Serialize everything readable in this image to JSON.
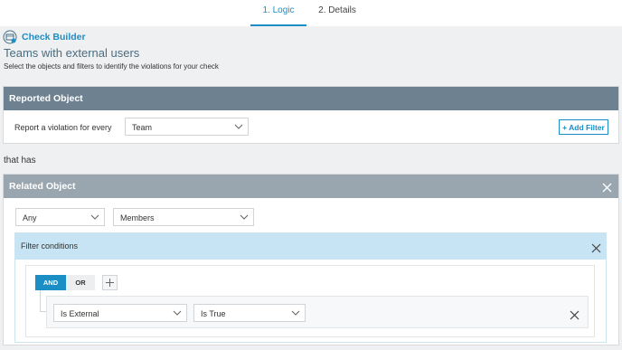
{
  "tabs": [
    {
      "label": "1. Logic",
      "active": true
    },
    {
      "label": "2. Details",
      "active": false
    }
  ],
  "header": {
    "app_title": "Check Builder",
    "page_title": "Teams with external users",
    "description": "Select the objects and filters to identify the violations for your check"
  },
  "reported_object": {
    "title": "Reported Object",
    "label": "Report a violation for every",
    "selected": "Team",
    "add_filter": "+ Add Filter"
  },
  "connector_text": "that has",
  "related_object": {
    "title": "Related Object",
    "quantifier": "Any",
    "relation": "Members",
    "filter_conditions": {
      "title": "Filter conditions",
      "and_label": "AND",
      "or_label": "OR",
      "conditions": [
        {
          "field": "Is External",
          "operator": "Is True"
        }
      ]
    }
  },
  "colors": {
    "accent": "#1b8ec6",
    "reported_header": "#6d8190",
    "related_header": "#99a6af",
    "filter_header": "#c6e4f3"
  },
  "icons": [
    "check-builder-icon",
    "chevron-down-icon",
    "close-icon",
    "plus-icon"
  ]
}
